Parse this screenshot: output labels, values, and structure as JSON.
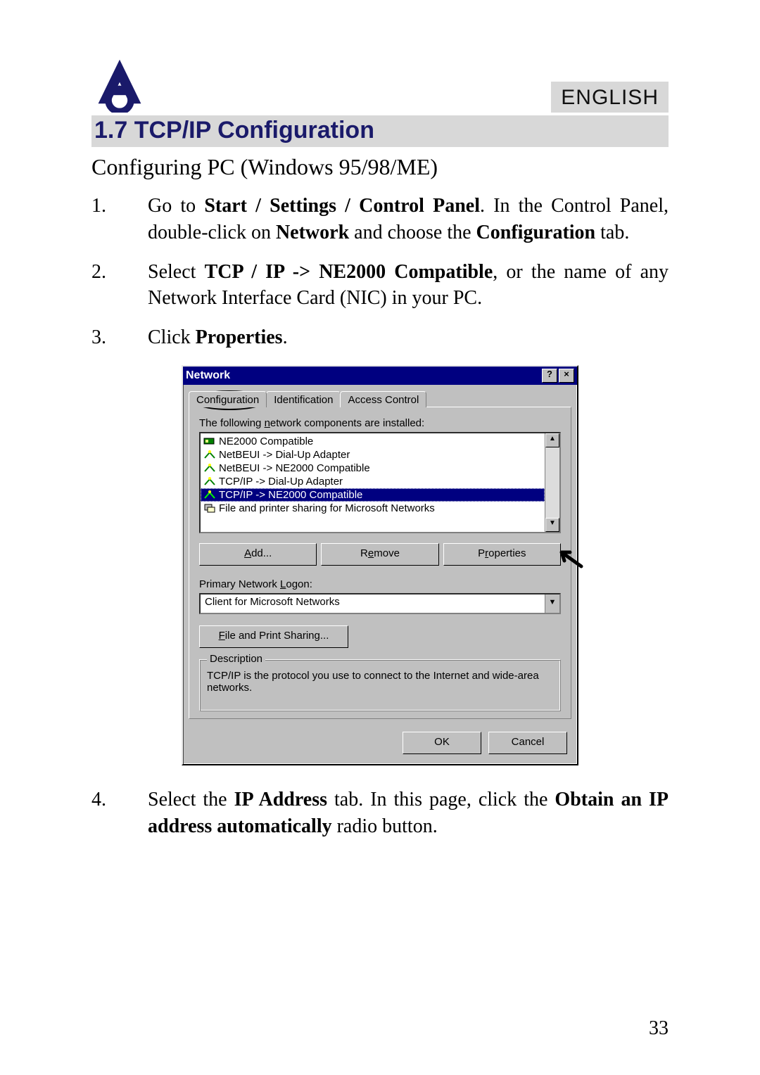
{
  "header": {
    "language": "ENGLISH"
  },
  "section": {
    "title": "1.7 TCP/IP Configuration",
    "subhead": "Configuring PC (Windows 95/98/ME)"
  },
  "steps": {
    "s1_a": "Go to ",
    "s1_b": "Start / Settings / Control Panel",
    "s1_c": ". In the Control Panel, double-click on ",
    "s1_d": "Network",
    "s1_e": " and choose the ",
    "s1_f": "Configuration",
    "s1_g": " tab.",
    "s2_a": "Select ",
    "s2_b": "TCP / IP -> NE2000 Compatible",
    "s2_c": ", or the name of any Network Interface Card (NIC) in your PC.",
    "s3_a": "Click ",
    "s3_b": "Properties",
    "s3_c": ".",
    "s4_a": "Select the ",
    "s4_b": "IP Address",
    "s4_c": " tab. In this page, click the ",
    "s4_d": "Obtain an IP address automatically",
    "s4_e": " radio button."
  },
  "dialog": {
    "title": "Network",
    "help_btn": "?",
    "close_btn": "×",
    "tabs": {
      "configuration": "Configuration",
      "identification": "Identification",
      "access_control": "Access Control"
    },
    "list_label": "The following network components are installed:",
    "items": [
      "NE2000 Compatible",
      "NetBEUI -> Dial-Up Adapter",
      "NetBEUI -> NE2000 Compatible",
      "TCP/IP -> Dial-Up Adapter",
      "TCP/IP -> NE2000 Compatible",
      "File and printer sharing for Microsoft Networks"
    ],
    "buttons": {
      "add": "Add...",
      "remove": "Remove",
      "properties": "Properties"
    },
    "logon_label": "Primary Network Logon:",
    "logon_value": "Client for Microsoft Networks",
    "file_print": "File and Print Sharing...",
    "description_legend": "Description",
    "description_text": "TCP/IP is the protocol you use to connect to the Internet and wide-area networks.",
    "ok": "OK",
    "cancel": "Cancel"
  },
  "page_number": "33"
}
